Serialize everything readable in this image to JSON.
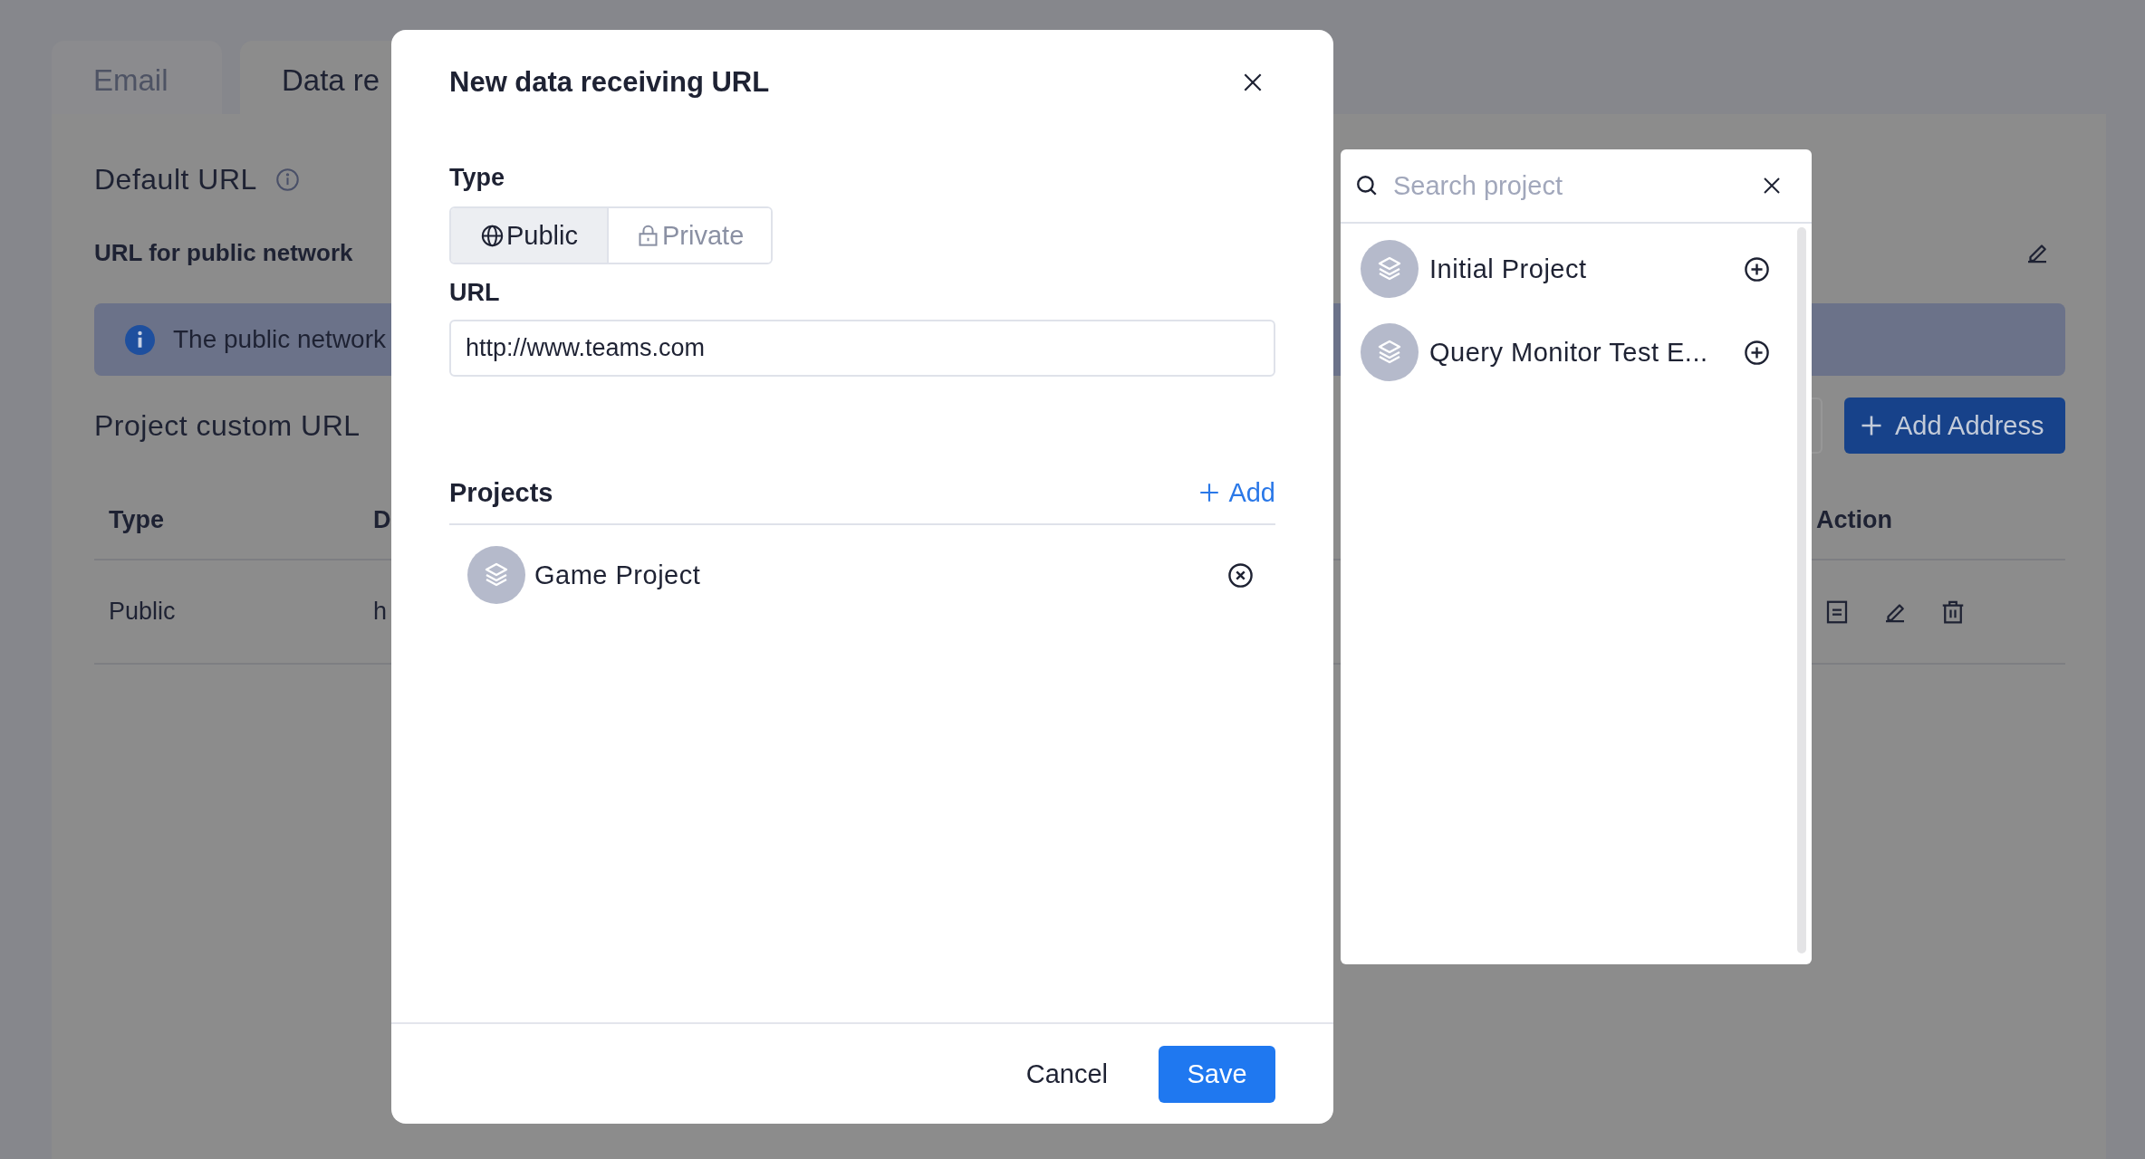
{
  "background": {
    "tabs": [
      {
        "label": "Email",
        "selected": false
      },
      {
        "label": "Data re",
        "selected": true
      }
    ],
    "default_url": {
      "title": "Default URL",
      "public_label": "URL for public network",
      "notice": "The public network"
    },
    "custom_url": {
      "title": "Project custom URL",
      "add_button": "Add Address",
      "table": {
        "columns": [
          "Type",
          "D",
          "Action"
        ],
        "rows": [
          {
            "type": "Public",
            "column_2": "h"
          }
        ]
      }
    }
  },
  "dialog": {
    "title": "New data receiving URL",
    "type_label": "Type",
    "type_options": [
      {
        "label": "Public",
        "selected": true
      },
      {
        "label": "Private",
        "selected": false
      }
    ],
    "url_label": "URL",
    "url_value": "http://www.teams.com",
    "projects_title": "Projects",
    "add_link": "Add",
    "projects": [
      {
        "name": "Game Project"
      }
    ],
    "buttons": {
      "cancel": "Cancel",
      "save": "Save"
    }
  },
  "project_picker": {
    "placeholder": "Search project",
    "items": [
      {
        "name": "Initial Project"
      },
      {
        "name": "Query Monitor Test E..."
      }
    ]
  }
}
